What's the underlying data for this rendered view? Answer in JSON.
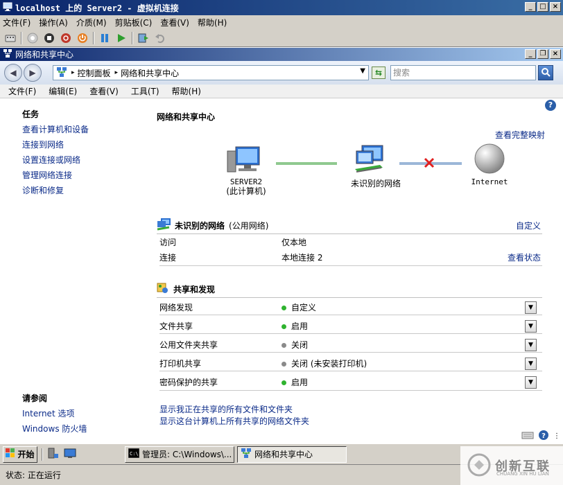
{
  "vm_window": {
    "title": "localhost 上的 Server2 - 虚拟机连接",
    "controls": [
      "_",
      "□",
      "×"
    ],
    "menu": [
      "文件(F)",
      "操作(A)",
      "介质(M)",
      "剪贴板(C)",
      "查看(V)",
      "帮助(H)"
    ]
  },
  "explorer": {
    "title": "网络和共享中心",
    "controls": [
      "_",
      "❐",
      "×"
    ],
    "breadcrumb": [
      "控制面板",
      "网络和共享中心"
    ],
    "search_placeholder": "搜索",
    "menu": [
      "文件(F)",
      "编辑(E)",
      "查看(V)",
      "工具(T)",
      "帮助(H)"
    ]
  },
  "sidebar": {
    "tasks_heading": "任务",
    "tasks": [
      "查看计算机和设备",
      "连接到网络",
      "设置连接或网络",
      "管理网络连接",
      "诊断和修复"
    ],
    "see_also_heading": "请参阅",
    "see_also": [
      "Internet 选项",
      "Windows 防火墙"
    ]
  },
  "main": {
    "title": "网络和共享中心",
    "view_full_map": "查看完整映射",
    "map": {
      "computer_name": "SERVER2",
      "computer_sub": "(此计算机)",
      "network_name": "未识别的网络",
      "internet": "Internet"
    },
    "network": {
      "name": "未识别的网络",
      "type": "(公用网络)",
      "customize": "自定义",
      "rows": [
        {
          "key": "访问",
          "value": "仅本地",
          "link": ""
        },
        {
          "key": "连接",
          "value": "本地连接 2",
          "link": "查看状态"
        }
      ]
    },
    "sharing": {
      "heading": "共享和发现",
      "rows": [
        {
          "key": "网络发现",
          "value": "自定义",
          "state": "on"
        },
        {
          "key": "文件共享",
          "value": "启用",
          "state": "on"
        },
        {
          "key": "公用文件夹共享",
          "value": "关闭",
          "state": "off"
        },
        {
          "key": "打印机共享",
          "value": "关闭 (未安装打印机)",
          "state": "off"
        },
        {
          "key": "密码保护的共享",
          "value": "启用",
          "state": "on"
        }
      ]
    },
    "bottom_links": [
      "显示我正在共享的所有文件和文件夹",
      "显示这台计算机上所有共享的网络文件夹"
    ]
  },
  "taskbar": {
    "start": "开始",
    "tasks": [
      {
        "label": "管理员: C:\\Windows\\...",
        "active": false
      },
      {
        "label": "网络和共享中心",
        "active": true
      }
    ]
  },
  "status": {
    "text": "状态: 正在运行"
  },
  "watermark": {
    "text": "创新互联",
    "sub": "CHUANG XIN HU LIAN"
  },
  "colors": {
    "on_dot": "#2fb32f",
    "off_dot": "#8a8a8a",
    "link": "#0a2a88",
    "title_bar": "#0a246a"
  }
}
